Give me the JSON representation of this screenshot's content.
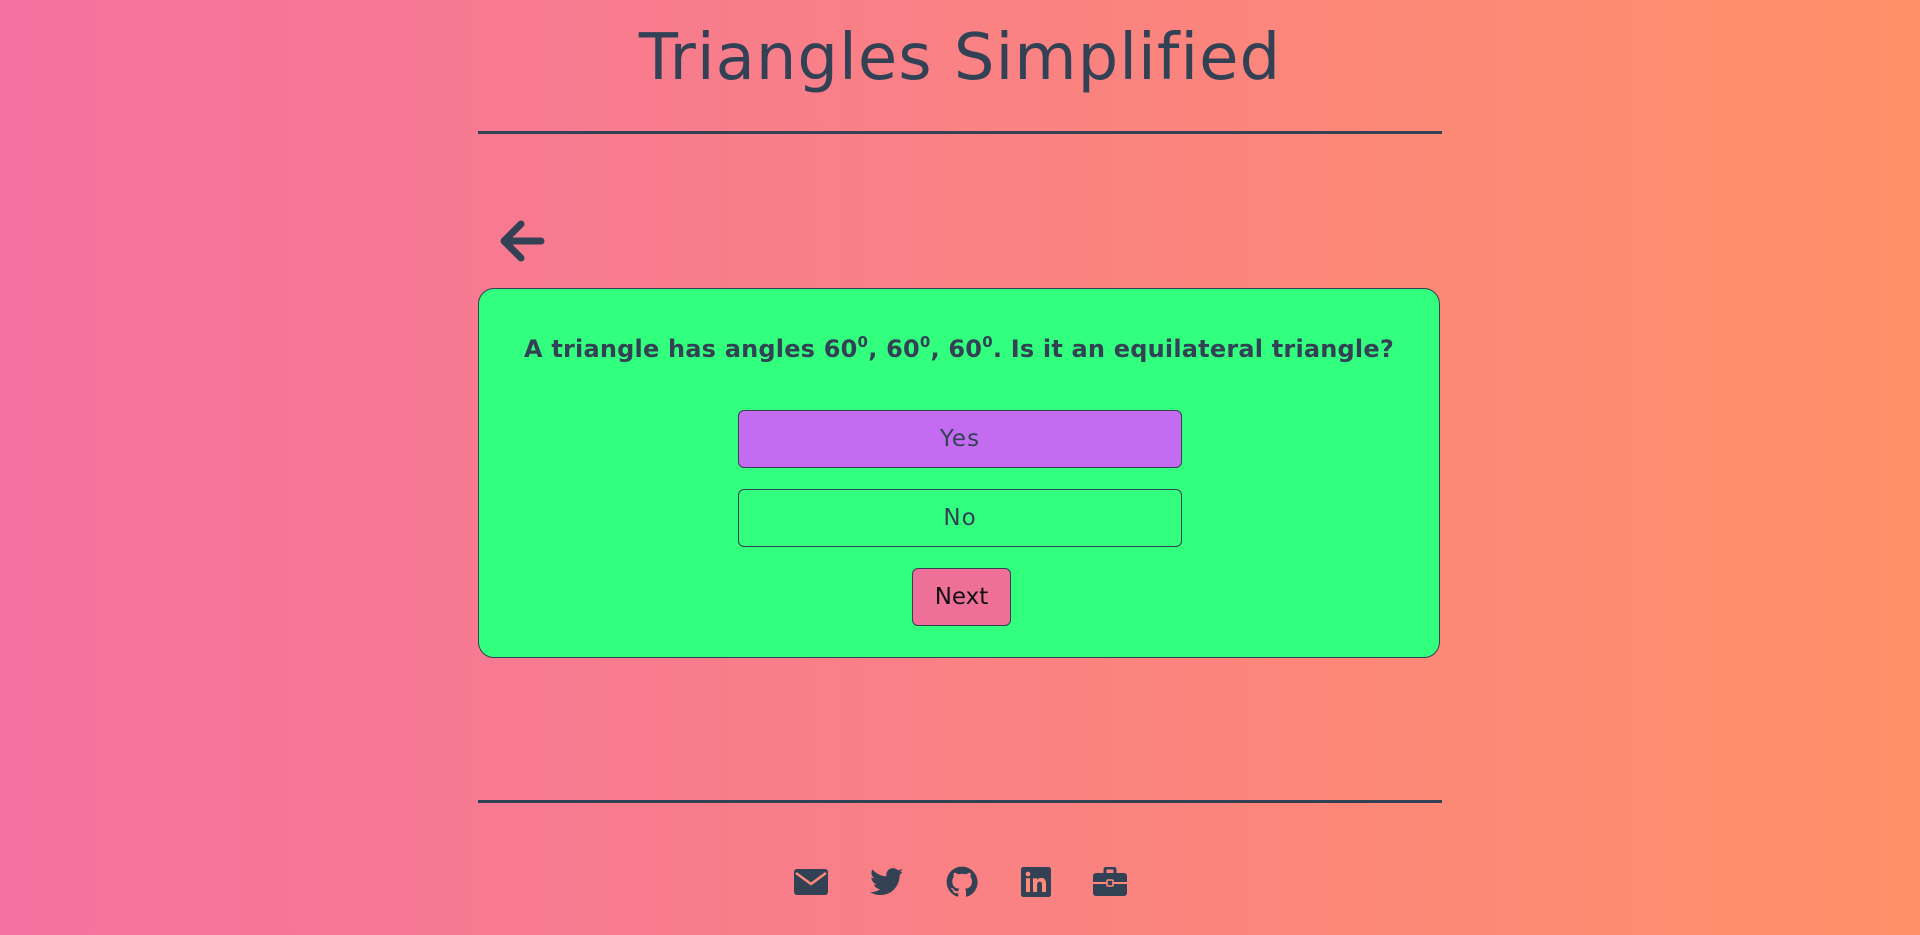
{
  "header": {
    "title": "Triangles Simplified"
  },
  "navigation": {
    "back_icon": "arrow-left-icon"
  },
  "quiz": {
    "question_prefix": "A triangle has angles ",
    "angle_1": "60",
    "angle_2": "60",
    "angle_3": "60",
    "degree_mark": "0",
    "separator": ", ",
    "question_suffix": ". Is it an equilateral triangle?",
    "options": [
      {
        "label": "Yes",
        "selected": true
      },
      {
        "label": "No",
        "selected": false
      }
    ],
    "next_label": "Next"
  },
  "footer": {
    "icons": [
      "envelope-icon",
      "twitter-icon",
      "github-icon",
      "linkedin-icon",
      "briefcase-icon"
    ]
  },
  "colors": {
    "text": "#334155",
    "card_bg": "#33ff7e",
    "selected_option": "#c36cf2",
    "next_button": "#ee6f98",
    "gradient_start": "#f472a0",
    "gradient_end": "#ff9068"
  }
}
